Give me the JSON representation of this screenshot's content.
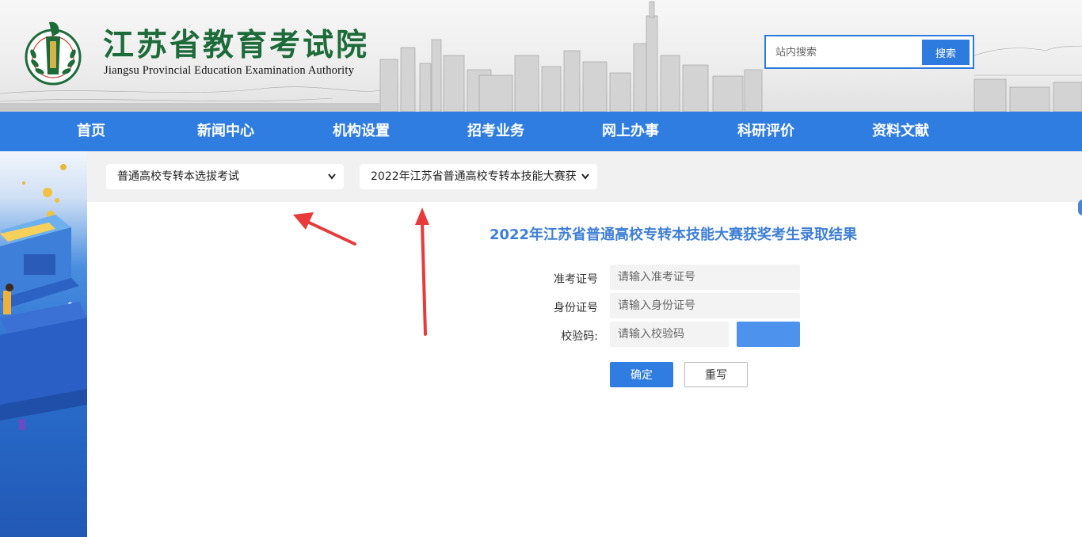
{
  "header": {
    "title_cn": "江苏省教育考试院",
    "title_en": "Jiangsu Provincial Education Examination Authority",
    "logo_text": "江苏省教育考试院",
    "search": {
      "placeholder": "站内搜索",
      "button_label": "搜索"
    }
  },
  "nav": {
    "items": [
      {
        "label": "首页"
      },
      {
        "label": "新闻中心"
      },
      {
        "label": "机构设置"
      },
      {
        "label": "招考业务"
      },
      {
        "label": "网上办事"
      },
      {
        "label": "科研评价"
      },
      {
        "label": "资料文献"
      }
    ]
  },
  "filters": {
    "exam_type": "普通高校专转本选拔考试",
    "exam_item": "2022年江苏省普通高校专转本技能大赛获"
  },
  "form": {
    "title": "2022年江苏省普通高校专转本技能大赛获奖考生录取结果",
    "admission_label": "准考证号",
    "admission_placeholder": "请输入准考证号",
    "id_label": "身份证号",
    "id_placeholder": "请输入身份证号",
    "captcha_label": "校验码:",
    "captcha_placeholder": "请输入校验码",
    "confirm_label": "确定",
    "reset_label": "重写"
  },
  "colors": {
    "primary_blue": "#2f7de1",
    "title_blue": "#3f7fd6",
    "logo_green": "#1e6b3a",
    "annotation_red": "#e83a3a"
  },
  "icons": [
    "search-icon",
    "chevron-down-icon",
    "logo-emblem",
    "annotation-arrow"
  ]
}
